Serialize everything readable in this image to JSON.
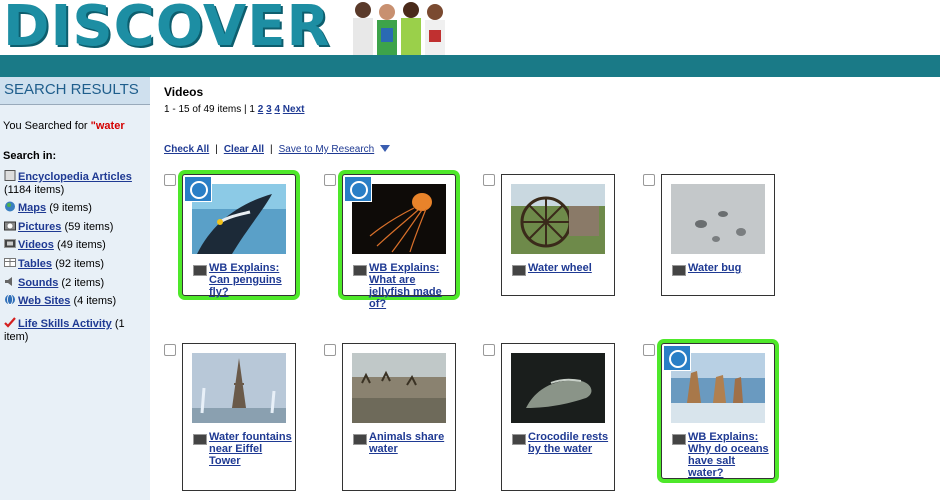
{
  "header": {
    "logo_text": "DISCOVER"
  },
  "sidebar": {
    "title": "SEARCH RESULTS",
    "searched_prefix": "You Searched for ",
    "searched_term": "\"water",
    "search_in_label": "Search in:",
    "items": [
      {
        "icon": "encyclopedia-icon",
        "label": "Encyclopedia Articles",
        "count": "(1184 items)"
      },
      {
        "icon": "globe-icon",
        "label": "Maps",
        "count": "(9 items)"
      },
      {
        "icon": "camera-icon",
        "label": "Pictures",
        "count": "(59 items)"
      },
      {
        "icon": "video-icon",
        "label": "Videos",
        "count": "(49 items)"
      },
      {
        "icon": "table-icon",
        "label": "Tables",
        "count": "(92 items)"
      },
      {
        "icon": "speaker-icon",
        "label": "Sounds",
        "count": "(2 items)"
      },
      {
        "icon": "web-icon",
        "label": "Web Sites",
        "count": "(4 items)"
      },
      {
        "icon": "checkmark-icon",
        "label": "Life Skills Activity",
        "count": "(1 item)"
      }
    ]
  },
  "main": {
    "section_title": "Videos",
    "pager": {
      "summary": "1 - 15 of 49 items |",
      "current": "1",
      "pages": [
        "2",
        "3",
        "4"
      ],
      "next": "Next"
    },
    "actions": {
      "check_all": "Check All",
      "clear_all": "Clear All",
      "save": "Save to My Research"
    },
    "cards": [
      {
        "title": "WB Explains: Can penguins fly?",
        "badge": true,
        "highlighted": true,
        "thumb": "penguin"
      },
      {
        "title": "WB Explains: What are jellyfish made of?",
        "badge": true,
        "highlighted": true,
        "thumb": "jellyfish"
      },
      {
        "title": "Water wheel",
        "badge": false,
        "highlighted": false,
        "thumb": "waterwheel"
      },
      {
        "title": "Water bug",
        "badge": false,
        "highlighted": false,
        "thumb": "waterbug"
      },
      {
        "title": "Water fountains near Eiffel Tower",
        "badge": false,
        "highlighted": false,
        "thumb": "eiffel"
      },
      {
        "title": "Animals share water",
        "badge": false,
        "highlighted": false,
        "thumb": "animals"
      },
      {
        "title": "Crocodile rests by the water",
        "badge": false,
        "highlighted": false,
        "thumb": "crocodile"
      },
      {
        "title": "WB Explains: Why do oceans have salt water?",
        "badge": true,
        "highlighted": true,
        "thumb": "ocean"
      }
    ]
  },
  "colors": {
    "accent_teal": "#1a7a87",
    "link_blue": "#1f3a93",
    "highlight_green": "#4ee82a",
    "search_term_red": "#d40000"
  }
}
